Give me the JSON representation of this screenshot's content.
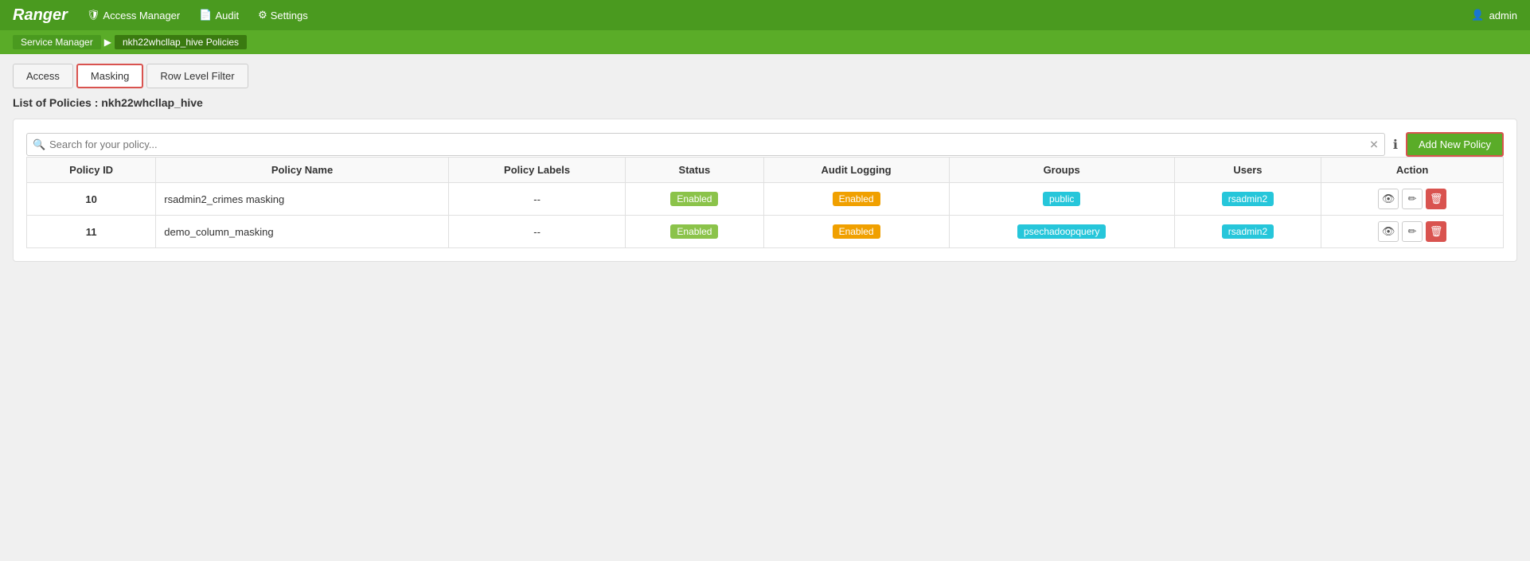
{
  "brand": "Ranger",
  "nav": {
    "access_manager": "Access Manager",
    "audit": "Audit",
    "settings": "Settings",
    "admin_user": "admin"
  },
  "breadcrumb": {
    "service_manager": "Service Manager",
    "current": "nkh22whcllap_hive Policies"
  },
  "tabs": [
    {
      "id": "access",
      "label": "Access",
      "active": false
    },
    {
      "id": "masking",
      "label": "Masking",
      "active": true
    },
    {
      "id": "row-level-filter",
      "label": "Row Level Filter",
      "active": false
    }
  ],
  "page_title": "List of Policies : nkh22whcllap_hive",
  "search": {
    "placeholder": "Search for your policy..."
  },
  "add_policy_label": "Add New Policy",
  "table": {
    "columns": [
      "Policy ID",
      "Policy Name",
      "Policy Labels",
      "Status",
      "Audit Logging",
      "Groups",
      "Users",
      "Action"
    ],
    "rows": [
      {
        "id": "10",
        "name": "rsadmin2_crimes masking",
        "labels": "--",
        "status": "Enabled",
        "audit_logging": "Enabled",
        "groups": "public",
        "users": "rsadmin2"
      },
      {
        "id": "11",
        "name": "demo_column_masking",
        "labels": "--",
        "status": "Enabled",
        "audit_logging": "Enabled",
        "groups": "psechadoopquery",
        "users": "rsadmin2"
      }
    ]
  }
}
